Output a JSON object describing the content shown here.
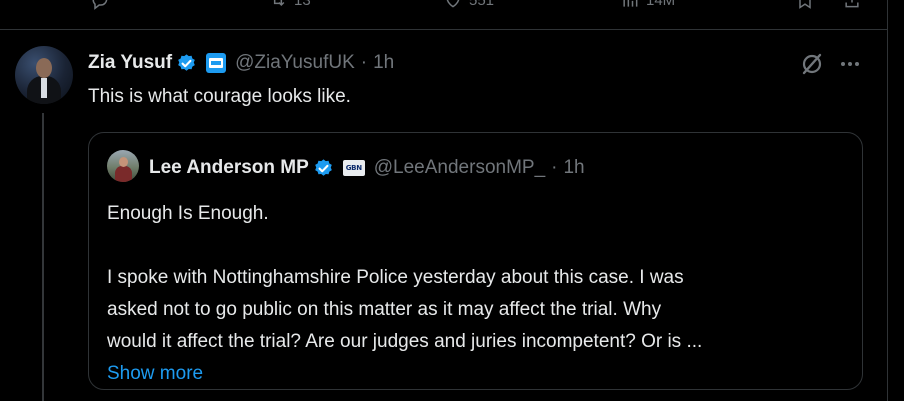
{
  "prev_tweet_actions": {
    "retweets": "13",
    "likes": "551",
    "views": "14M"
  },
  "tweet": {
    "author_name": "Zia Yusuf",
    "author_handle": "@ZiaYusufUK",
    "separator": "·",
    "time": "1h",
    "text": "This is what courage looks like."
  },
  "quoted": {
    "author_name": "Lee Anderson MP",
    "affiliate_badge_text": "GBN",
    "author_handle": "@LeeAndersonMP_",
    "separator": "·",
    "time": "1h",
    "line1": "Enough Is Enough.",
    "line2": "I spoke with Nottinghamshire Police yesterday about this case. I was",
    "line3": "asked not to go public on this matter as it may affect the trial. Why",
    "line4": "would it affect the trial? Are our judges and juries incompetent? Or is ...",
    "show_more": "Show more"
  },
  "colors": {
    "background": "#000000",
    "text": "#e7e9ea",
    "muted": "#71767b",
    "accent": "#1d9bf0",
    "border": "#2f3336"
  },
  "icons": [
    "reply-icon",
    "retweet-icon",
    "like-icon",
    "views-icon",
    "bookmark-icon",
    "share-icon",
    "verified-icon",
    "affiliate-badge-icon",
    "grok-icon",
    "more-icon"
  ]
}
